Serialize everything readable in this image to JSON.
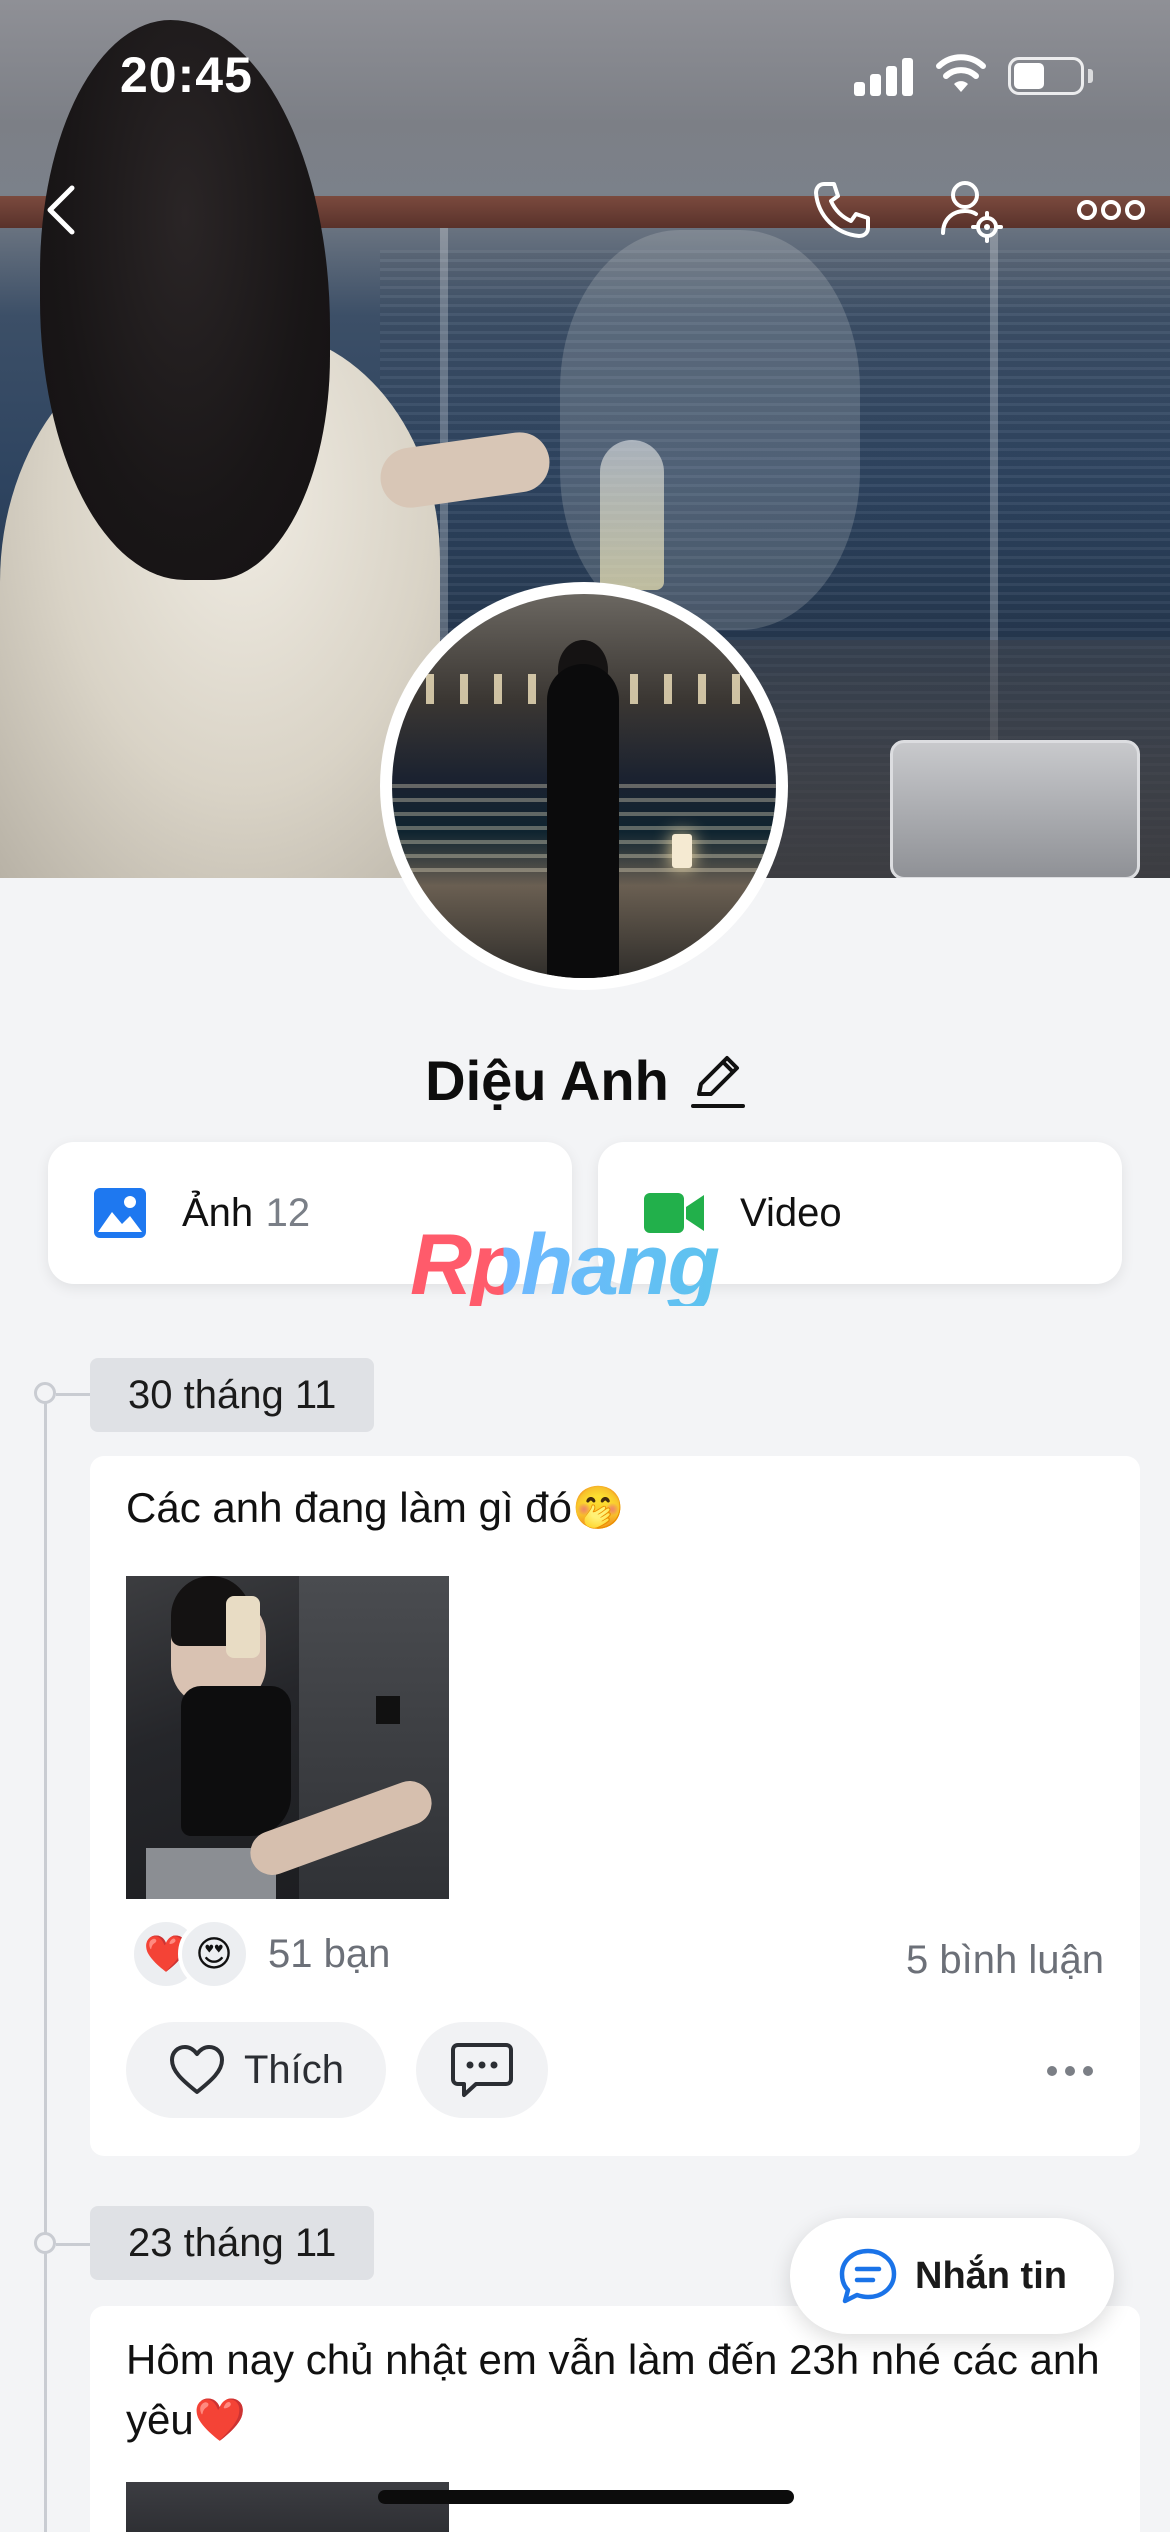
{
  "status_bar": {
    "time": "20:45"
  },
  "profile": {
    "name": "Diệu Anh"
  },
  "media": {
    "photos": {
      "label": "Ảnh",
      "count": "12"
    },
    "videos": {
      "label": "Video"
    }
  },
  "watermark": "Rphang",
  "posts": [
    {
      "date": "30 tháng 11",
      "text": "Các anh đang làm gì đó🤭",
      "reactions": [
        "❤️",
        "😍"
      ],
      "reaction_count": "51 bạn",
      "comment_count": "5 bình luận",
      "like_label": "Thích"
    },
    {
      "date": "23 tháng 11",
      "text": "Hôm nay chủ nhật em vẫn làm đến 23h nhé các anh yêu❤️"
    }
  ],
  "fab": {
    "label": "Nhắn tin"
  },
  "colors": {
    "accent_blue": "#1a73e8",
    "video_green": "#22b04b",
    "photo_blue": "#1e78f0"
  }
}
